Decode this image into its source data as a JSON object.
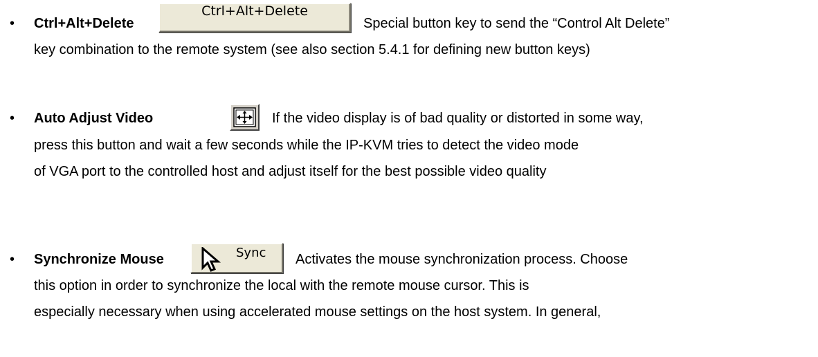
{
  "items": [
    {
      "term": "Ctrl+Alt+Delete",
      "button_label": "Ctrl+Alt+Delete",
      "line1": "Special button key to send the “Control Alt Delete”",
      "line2": "key combination to the remote system (see also section 5.4.1 for defining new button keys)"
    },
    {
      "term": "Auto Adjust Video",
      "icon": "auto-adjust-arrows-icon",
      "line1": "If the video display is of bad quality or distorted in some way,",
      "line2": "press this button and wait a few seconds while the IP-KVM tries to detect the video mode",
      "line3": "of VGA port to the controlled host and adjust itself for the best possible video quality"
    },
    {
      "term": "Synchronize Mouse",
      "button_label": "Sync",
      "icon": "mouse-cursor-icon",
      "line1": "Activates the mouse synchronization process. Choose",
      "line2": "this option in order to synchronize the local with the remote mouse cursor. This is",
      "line3": "especially necessary when using accelerated mouse settings on the host system. In general,"
    }
  ],
  "bullet_glyph": "•"
}
